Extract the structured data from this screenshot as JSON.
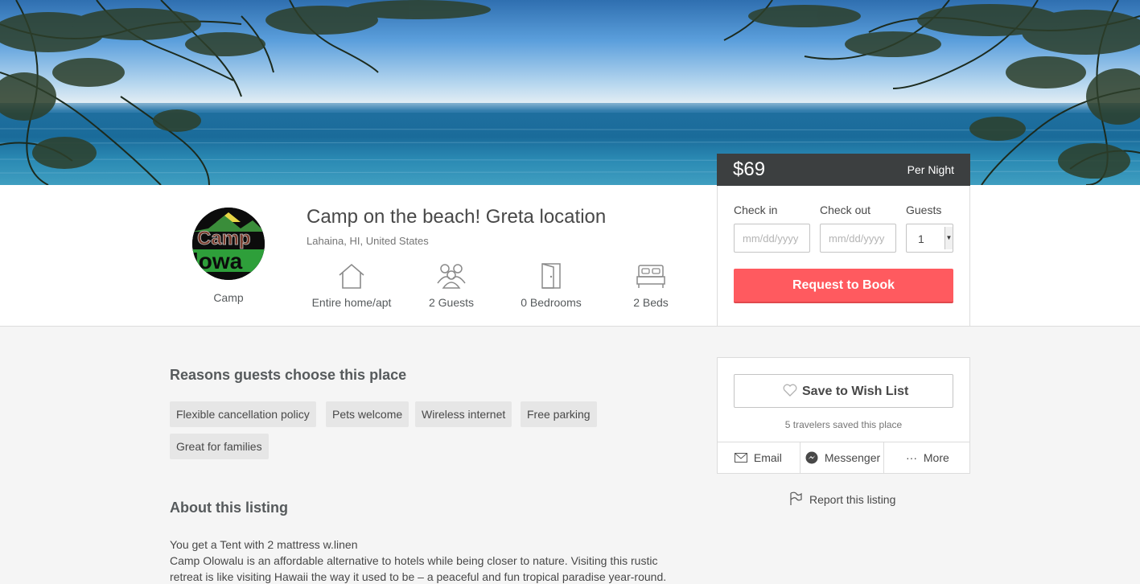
{
  "hero": {
    "image_alt": "Ocean view through trees"
  },
  "host": {
    "type": "Camp",
    "logo_text_top": "Camp",
    "logo_text_bottom": "lowa"
  },
  "listing": {
    "title": "Camp on the beach! Greta location",
    "location": "Lahaina, HI, United States",
    "features": [
      {
        "icon": "house-icon",
        "label": "Entire home/apt"
      },
      {
        "icon": "guests-icon",
        "label": "2 Guests"
      },
      {
        "icon": "door-icon",
        "label": "0 Bedrooms"
      },
      {
        "icon": "bed-icon",
        "label": "2 Beds"
      }
    ]
  },
  "booking": {
    "price": "$69",
    "period": "Per Night",
    "check_in_label": "Check in",
    "check_out_label": "Check out",
    "guests_label": "Guests",
    "date_placeholder": "mm/dd/yyyy",
    "guests_value": "1",
    "request_label": "Request to Book"
  },
  "reasons": {
    "heading": "Reasons guests choose this place",
    "tags": [
      "Flexible cancellation policy",
      "Pets welcome",
      "Wireless internet",
      "Free parking",
      "Great for families"
    ]
  },
  "about": {
    "heading": "About this listing",
    "line1": "You get a Tent with 2 mattress w.linen",
    "line2": "Camp Olowalu is an affordable alternative to hotels while being closer to nature. Visiting this rustic retreat is like visiting Hawaii the way it used to be – a peaceful and fun tropical paradise year-round."
  },
  "share": {
    "wishlist_label": "Save to Wish List",
    "saved_count": "5 travelers saved this place",
    "email_label": "Email",
    "messenger_label": "Messenger",
    "more_label": "More",
    "report_label": "Report this listing"
  },
  "colors": {
    "accent": "#ff5a5f",
    "price_bar": "#3c3f40",
    "tag_bg": "#e6e6e6"
  }
}
